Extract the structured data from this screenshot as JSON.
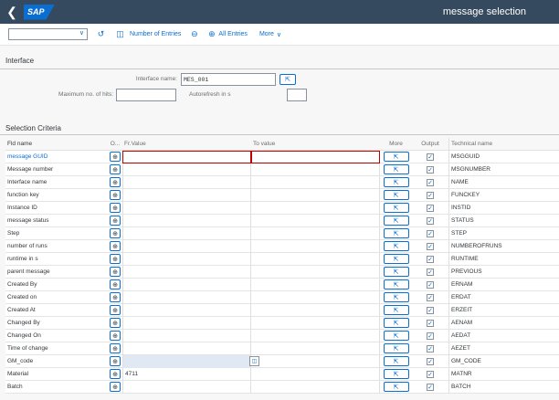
{
  "shell": {
    "back_icon": "back-arrow-icon",
    "logo": "SAP",
    "title": "message selection"
  },
  "toolbar": {
    "variant_value": "",
    "number_of_entries": "Number of Entries",
    "all_entries": "All Entries",
    "more": "More"
  },
  "interface": {
    "title": "Interface",
    "interface_name_label": "Interface name:",
    "interface_name_value": "MES_001",
    "max_hits_label": "Maximum no. of hits:",
    "max_hits_value": "",
    "autorefresh_label": "Autorefresh in s",
    "autorefresh_value": ""
  },
  "selection": {
    "title": "Selection Criteria",
    "headers": {
      "name": "Fld name",
      "op": "O...",
      "from": "Fr.Value",
      "to": "To value",
      "more": "More",
      "output": "Output",
      "tech": "Technical name"
    },
    "rows": [
      {
        "name": "message GUID",
        "from": "",
        "to": "",
        "tech": "MSGGUID"
      },
      {
        "name": "Message number",
        "from": "",
        "to": "",
        "tech": "MSGNUMBER"
      },
      {
        "name": "Interface name",
        "from": "",
        "to": "",
        "tech": "NAME"
      },
      {
        "name": "function key",
        "from": "",
        "to": "",
        "tech": "FUNCKEY"
      },
      {
        "name": "Instance ID",
        "from": "",
        "to": "",
        "tech": "INSTID"
      },
      {
        "name": "message status",
        "from": "",
        "to": "",
        "tech": "STATUS"
      },
      {
        "name": "Step",
        "from": "",
        "to": "",
        "tech": "STEP"
      },
      {
        "name": "number of runs",
        "from": "",
        "to": "",
        "tech": "NUMBEROFRUNS"
      },
      {
        "name": "runtime in s",
        "from": "",
        "to": "",
        "tech": "RUNTIME"
      },
      {
        "name": "parent message",
        "from": "",
        "to": "",
        "tech": "PREVIOUS"
      },
      {
        "name": "Created By",
        "from": "",
        "to": "",
        "tech": "ERNAM"
      },
      {
        "name": "Created on",
        "from": "",
        "to": "",
        "tech": "ERDAT"
      },
      {
        "name": "Created At",
        "from": "",
        "to": "",
        "tech": "ERZEIT"
      },
      {
        "name": "Changed By",
        "from": "",
        "to": "",
        "tech": "AENAM"
      },
      {
        "name": "Changed On",
        "from": "",
        "to": "",
        "tech": "AEDAT"
      },
      {
        "name": "Time of change",
        "from": "",
        "to": "",
        "tech": "AEZET"
      },
      {
        "name": "GM_code",
        "from": "",
        "to": "",
        "tech": "GM_CODE"
      },
      {
        "name": "Material",
        "from": "4711",
        "to": "",
        "tech": "MATNR"
      },
      {
        "name": "Batch",
        "from": "",
        "to": "",
        "tech": "BATCH"
      }
    ]
  },
  "colors": {
    "shell": "#354a5f",
    "accent": "#0a6ed1",
    "error": "#bb0000"
  }
}
